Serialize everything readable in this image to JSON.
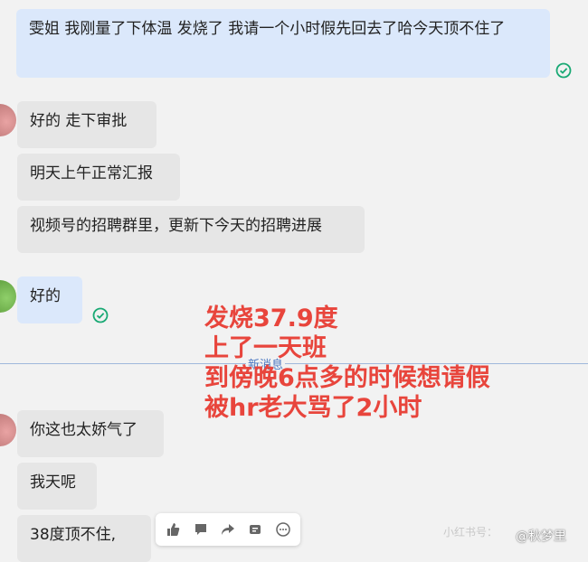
{
  "messages": {
    "m1": "雯姐 我刚量了下体温 发烧了 我请一个小时假先回去了哈今天顶不住了",
    "m2": "好的  走下审批",
    "m3": "明天上午正常汇报",
    "m4": "视频号的招聘群里，更新下今天的招聘进展",
    "m5": "好的",
    "m6": "你这也太娇气了",
    "m7": "我天呢",
    "m8": "38度顶不住,"
  },
  "divider": {
    "label": "新消息"
  },
  "overlay": {
    "lines": [
      "发烧37.9度",
      "上了一天班",
      "到傍晚6点多的时候想请假",
      "被hr老大骂了2小时"
    ]
  },
  "watermark": {
    "text": "小红书号：",
    "weibo": "@秋梦里"
  },
  "colors": {
    "outgoing_bubble": "#dbe8fb",
    "incoming_bubble": "#e6e6e6",
    "overlay_text": "#e8453c",
    "read_check": "#19a974"
  },
  "icons": [
    "thumbs-up-icon",
    "comment-icon",
    "forward-icon",
    "quote-icon",
    "more-icon",
    "read-check-icon"
  ]
}
